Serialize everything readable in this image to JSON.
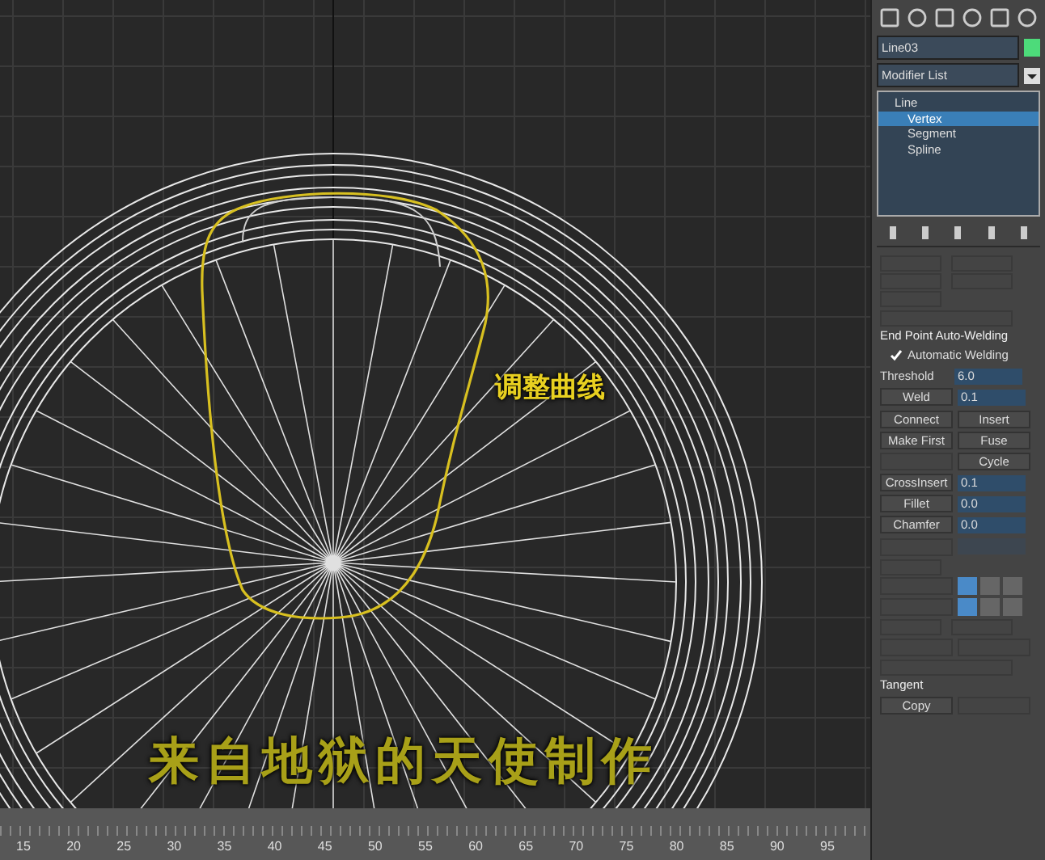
{
  "object_name": "Line03",
  "modifier_list": "Modifier List",
  "stack": [
    {
      "label": "Line",
      "selected": false,
      "children": [
        {
          "label": "Vertex",
          "selected": true
        },
        {
          "label": "Segment",
          "selected": false
        },
        {
          "label": "Spline",
          "selected": false
        }
      ]
    }
  ],
  "auto_weld": {
    "title": "End Point Auto-Welding",
    "checkbox": {
      "label": "Automatic Welding",
      "checked": true
    },
    "threshold": {
      "label": "Threshold",
      "value": "6.0"
    }
  },
  "geometry": [
    {
      "kind": "spinner",
      "label": "Weld",
      "value": "0.1"
    },
    {
      "kind": "pair",
      "left": "Connect",
      "right": "Insert"
    },
    {
      "kind": "pair",
      "left": "Make First",
      "right": "Fuse"
    },
    {
      "kind": "right",
      "right": "Cycle"
    },
    {
      "kind": "spinner",
      "label": "CrossInsert",
      "value": "0.1"
    },
    {
      "kind": "spinner",
      "label": "Fillet",
      "value": "0.0"
    },
    {
      "kind": "spinner",
      "label": "Chamfer",
      "value": "0.0"
    }
  ],
  "tangent": {
    "label": "Tangent",
    "button": "Copy"
  },
  "annotations": [
    {
      "kind": "note",
      "text": "调整曲线"
    },
    {
      "kind": "credit",
      "text": "来自地狱的天使制作"
    }
  ],
  "ruler": [
    "15",
    "20",
    "25",
    "30",
    "35",
    "40",
    "45",
    "50",
    "55",
    "60",
    "65",
    "70",
    "75",
    "80",
    "85",
    "90",
    "95"
  ]
}
